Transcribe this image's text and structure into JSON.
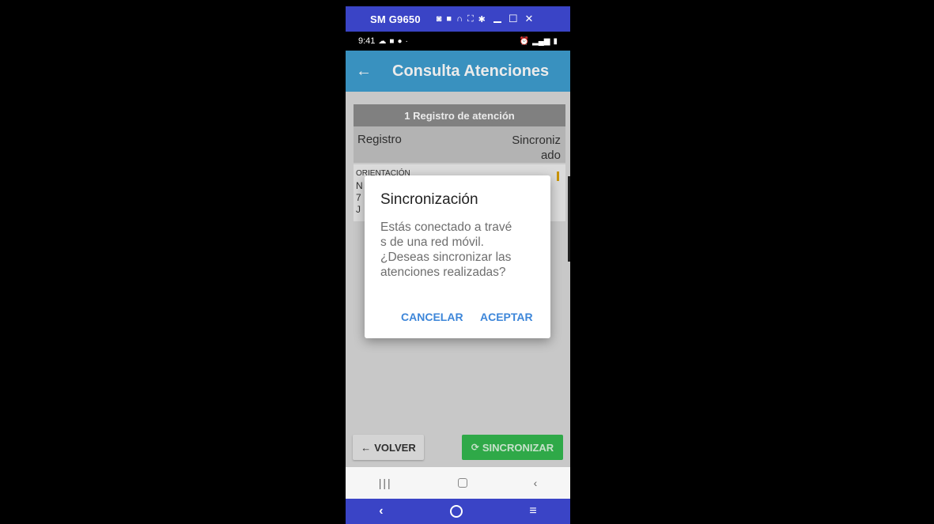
{
  "window": {
    "title": "SM G9650",
    "tools": [
      "camera-icon",
      "video-icon",
      "headset-icon",
      "fullscreen-icon",
      "settings-icon"
    ],
    "controls": [
      "minimize-icon",
      "maximize-icon",
      "close-icon"
    ]
  },
  "statusbar": {
    "time": "9:41",
    "left_icons": [
      "cloud-icon",
      "mail-icon",
      "chat-icon",
      "dot-icon"
    ],
    "right_icons": [
      "alarm-icon",
      "signal-icon",
      "battery-icon"
    ]
  },
  "appbar": {
    "back_glyph": "←",
    "title": "Consulta Atenciones"
  },
  "table": {
    "header": "1 Registro de atención",
    "columns": {
      "left": "Registro",
      "right_line1": "Sincroniz",
      "right_line2": "ado"
    },
    "rows": [
      {
        "type": "ORIENTACIÓN",
        "line1": "N",
        "line2": "7",
        "line3": "J"
      }
    ]
  },
  "footer": {
    "back_label": "VOLVER",
    "back_glyph": "←",
    "sync_label": "SINCRONIZAR",
    "sync_glyph": "⟳"
  },
  "android_nav": {
    "recent": "|||",
    "home": "home-square-icon",
    "back": "‹"
  },
  "window_nav": {
    "back": "‹",
    "home": "home-circle-icon",
    "menu": "≡"
  },
  "dialog": {
    "title": "Sincronización",
    "message_lines": [
      "Estás conectado a travé",
      "s de una red móvil.",
      "¿Deseas sincronizar las",
      "atenciones realizadas?"
    ],
    "cancel_label": "CANCELAR",
    "accept_label": "ACEPTAR"
  },
  "colors": {
    "window_bar": "#3a44c6",
    "appbar": "#3e9ed0",
    "sync_button": "#33b84f",
    "dialog_action": "#3d86d9"
  }
}
